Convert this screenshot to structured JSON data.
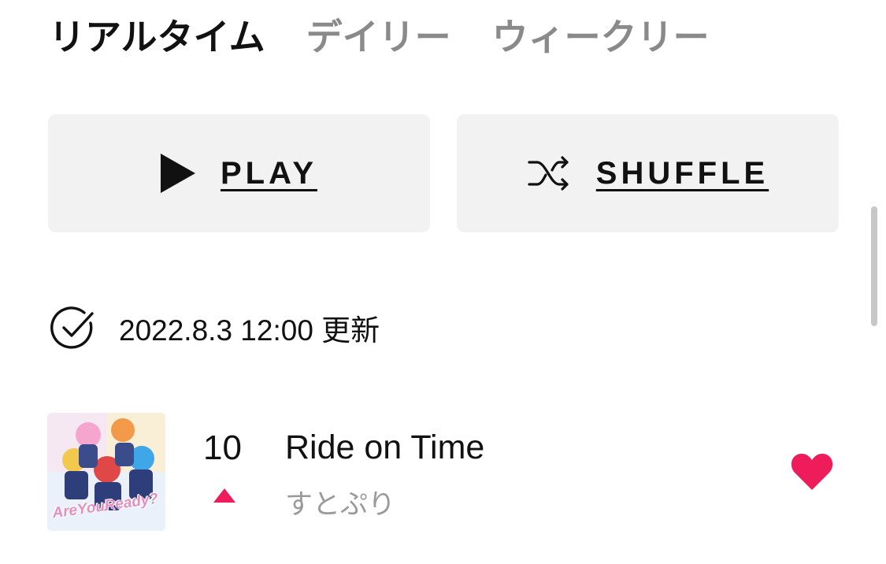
{
  "tabs": [
    {
      "label": "リアルタイム",
      "active": true
    },
    {
      "label": "デイリー",
      "active": false
    },
    {
      "label": "ウィークリー",
      "active": false
    }
  ],
  "actions": {
    "play_label": "PLAY",
    "shuffle_label": "SHUFFLE",
    "play_icon": "play-icon",
    "shuffle_icon": "shuffle-icon"
  },
  "updated": {
    "icon": "check-circle-icon",
    "text": "2022.8.3 12:00 更新"
  },
  "tracks": [
    {
      "rank": "10",
      "trend": "up",
      "title": "Ride on Time",
      "artist": "すとぷり",
      "artwork_text": "AreYouReady?",
      "liked": true
    }
  ],
  "colors": {
    "accent": "#ee1c5a",
    "button_bg": "#f2f2f2",
    "inactive_tab": "#8a8a8a"
  }
}
